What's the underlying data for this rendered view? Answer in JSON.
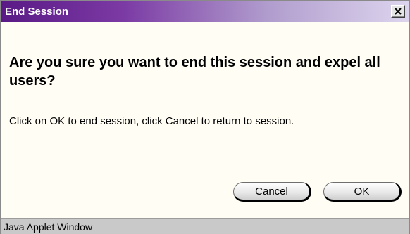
{
  "window": {
    "title": "End Session"
  },
  "dialog": {
    "question": "Are you sure you want to end this session and expel all users?",
    "instructions": "Click on OK to end session, click Cancel to return to session."
  },
  "buttons": {
    "cancel_label": "Cancel",
    "ok_label": "OK"
  },
  "status_bar": {
    "text": "Java Applet Window"
  },
  "icons": {
    "close": "close-icon"
  },
  "colors": {
    "titlebar_start": "#5a1a86",
    "titlebar_end": "#ddd5ee",
    "background": "#fffdf4",
    "status_bar": "#c9c9c9"
  }
}
